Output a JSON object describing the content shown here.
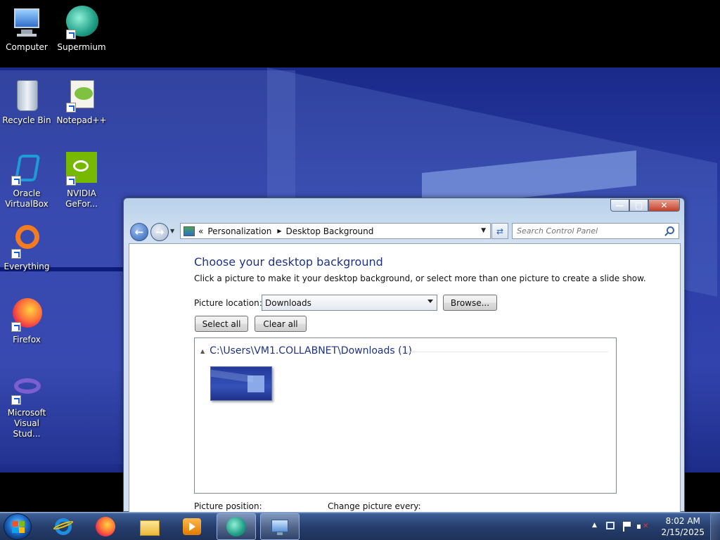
{
  "desktop": {
    "icons": [
      {
        "label": "Computer"
      },
      {
        "label": "Supermium"
      },
      {
        "label": "Recycle Bin"
      },
      {
        "label": "Notepad++"
      },
      {
        "label": "Oracle VirtualBox"
      },
      {
        "label": "NVIDIA GeFor..."
      },
      {
        "label": "Everything"
      },
      {
        "label": "Firefox"
      },
      {
        "label": "Microsoft Visual Stud..."
      }
    ]
  },
  "window": {
    "breadcrumb": {
      "overflow": "«",
      "items": [
        "Personalization",
        "Desktop Background"
      ]
    },
    "search": {
      "placeholder": "Search Control Panel"
    },
    "heading": "Choose your desktop background",
    "instructions": "Click a picture to make it your desktop background, or select more than one picture to create a slide show.",
    "picture_location": {
      "label": "Picture location:",
      "value": "Downloads"
    },
    "browse_label": "Browse...",
    "select_all_label": "Select all",
    "clear_all_label": "Clear all",
    "group": {
      "title": "C:\\Users\\VM1.COLLABNET\\Downloads (1)"
    },
    "picture_position_label": "Picture position:",
    "change_picture_label": "Change picture every:"
  },
  "taskbar": {
    "items": [
      "internet-explorer",
      "firefox",
      "file-explorer",
      "media-player",
      "supermium",
      "control-panel"
    ],
    "clock": {
      "time": "8:02 AM",
      "date": "2/15/2025"
    }
  },
  "colors": {
    "heading_blue": "#1e3287",
    "close_red": "#c4402b"
  }
}
